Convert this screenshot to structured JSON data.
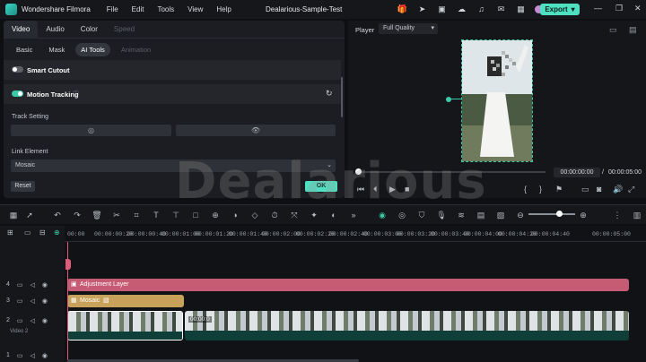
{
  "app": {
    "name": "Wondershare Filmora",
    "menu": [
      "File",
      "Edit",
      "Tools",
      "View",
      "Help"
    ],
    "project_title": "Dealarious-Sample-Test",
    "export_label": "Export",
    "top_icons": [
      "gift-icon",
      "send-icon",
      "media-icon",
      "cloud-icon",
      "headset-icon",
      "chat-icon",
      "grid-icon",
      "avatar"
    ],
    "window_controls": [
      "minimize-icon",
      "restore-icon",
      "close-icon"
    ]
  },
  "panel": {
    "main_tabs": [
      {
        "label": "Video",
        "state": "active"
      },
      {
        "label": "Audio",
        "state": "normal"
      },
      {
        "label": "Color",
        "state": "normal"
      },
      {
        "label": "Speed",
        "state": "disabled"
      }
    ],
    "sub_tabs": [
      {
        "label": "Basic",
        "state": "normal"
      },
      {
        "label": "Mask",
        "state": "normal"
      },
      {
        "label": "AI Tools",
        "state": "active"
      },
      {
        "label": "Animation",
        "state": "disabled"
      }
    ],
    "smart_cutout": {
      "label": "Smart Cutout",
      "enabled": false
    },
    "motion_tracking": {
      "label": "Motion Tracking",
      "enabled": true
    },
    "track_setting_label": "Track Setting",
    "link_element_label": "Link Element",
    "link_element_value": "Mosaic",
    "reset_label": "Reset",
    "ok_label": "OK"
  },
  "player": {
    "label": "Player",
    "quality": "Full Quality",
    "current_time": "00:00:00:00",
    "total_time": "00:00:05:00",
    "time_separator": "/"
  },
  "timeline": {
    "ruler_ticks": [
      "00:00",
      "00:00:00:20",
      "00:00:00:40",
      "00:00:01:00",
      "00:00:01:20",
      "00:00:01:40",
      "00:00:02:00",
      "00:00:02:20",
      "00:00:02:40",
      "00:00:03:00",
      "00:00:03:20",
      "00:00:03:40",
      "00:00:04:00",
      "00:00:04:20",
      "00:00:04:40",
      "00:00:05:00"
    ],
    "track_numbers": [
      "4",
      "3",
      "2",
      "1"
    ],
    "track_name": "Video 2",
    "adjustment_clip": "Adjustment Layer",
    "mosaic_clip": "Mosaic",
    "video_clip_label": "00:00:0"
  },
  "watermark": "Dealarious",
  "colors": {
    "accent": "#4fe0c2",
    "adjustment": "#c65b74",
    "mosaic": "#c8a15a",
    "playhead": "#e05a7a"
  }
}
